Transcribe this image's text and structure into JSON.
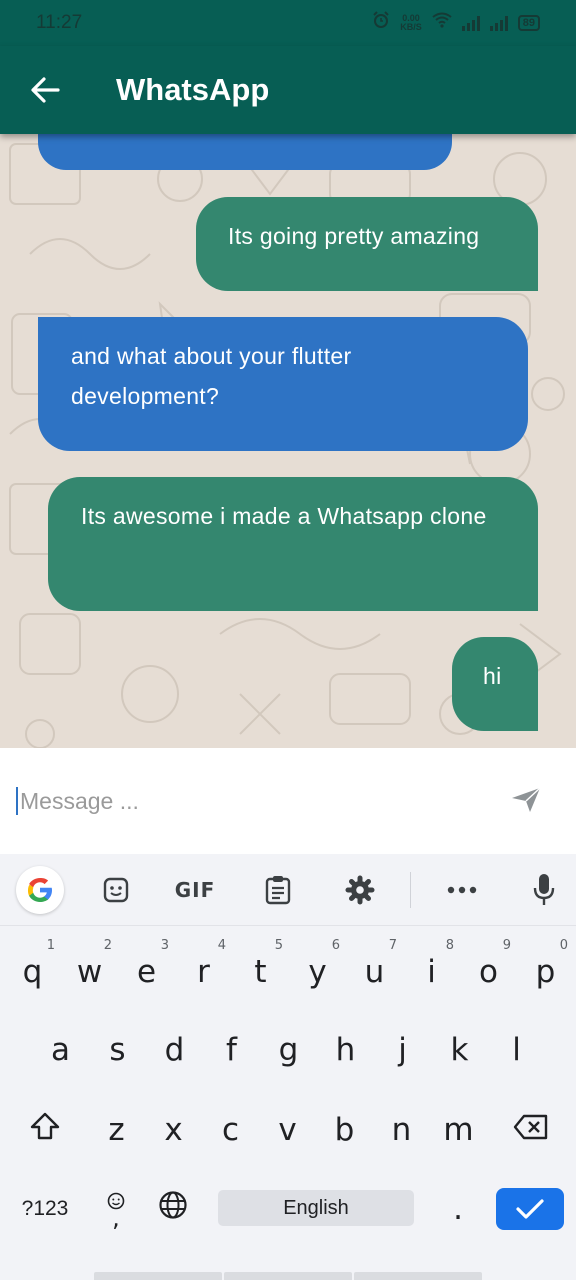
{
  "status_bar": {
    "time": "11:27",
    "speed_value": "0.00",
    "speed_unit": "KB/S",
    "battery": "89"
  },
  "app_bar": {
    "title": "WhatsApp"
  },
  "messages": [
    {
      "side": "left",
      "color": "#2e73c4",
      "text": ""
    },
    {
      "side": "right",
      "color": "#34876f",
      "text": "Its going pretty amazing"
    },
    {
      "side": "left",
      "color": "#2e73c4",
      "text": "and what about your flutter development?"
    },
    {
      "side": "right",
      "color": "#34876f",
      "text": "Its awesome i made a Whatsapp clone"
    },
    {
      "side": "right",
      "color": "#34876f",
      "text": "hi"
    }
  ],
  "input": {
    "placeholder": "Message ...",
    "value": ""
  },
  "keyboard": {
    "toolbar": [
      "google-logo",
      "sticker-icon",
      "GIF",
      "clipboard-icon",
      "settings-icon",
      "more-icon",
      "mic-icon"
    ],
    "gif_label": "GIF",
    "row1": [
      "q",
      "w",
      "e",
      "r",
      "t",
      "y",
      "u",
      "i",
      "o",
      "p"
    ],
    "row1_hints": [
      "1",
      "2",
      "3",
      "4",
      "5",
      "6",
      "7",
      "8",
      "9",
      "0"
    ],
    "row2": [
      "a",
      "s",
      "d",
      "f",
      "g",
      "h",
      "j",
      "k",
      "l"
    ],
    "row3": [
      "z",
      "x",
      "c",
      "v",
      "b",
      "n",
      "m"
    ],
    "symbols_label": "?123",
    "comma": ",",
    "space_label": "English",
    "period": "."
  },
  "colors": {
    "header": "#075e54",
    "incoming": "#2e73c4",
    "outgoing": "#34876f",
    "chat_bg": "#e6ddd4",
    "enter_key": "#1a73e8"
  }
}
